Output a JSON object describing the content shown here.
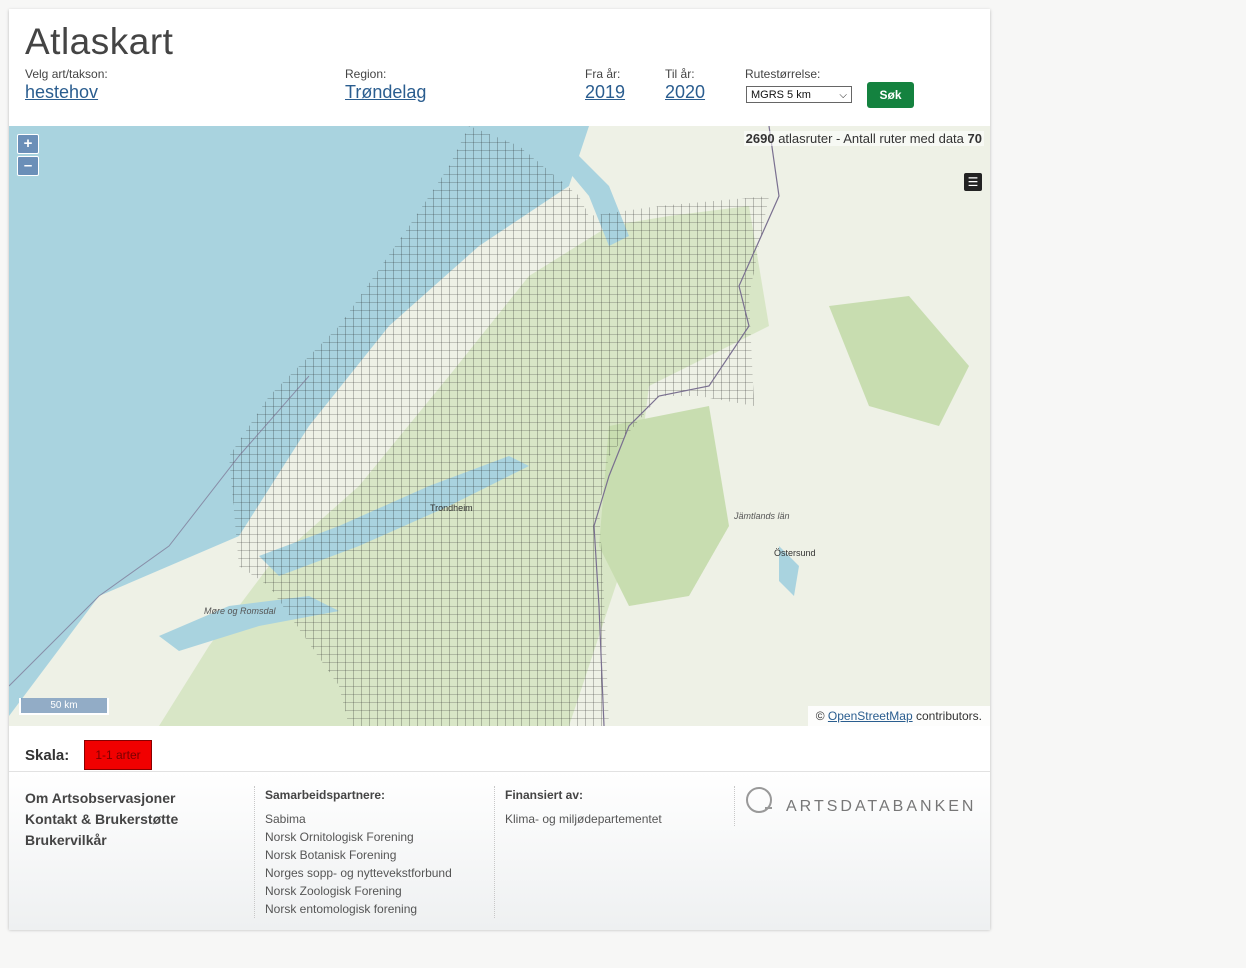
{
  "page_title": "Atlaskart",
  "filters": {
    "species_label": "Velg art/takson:",
    "species_value": "hestehov",
    "region_label": "Region:",
    "region_value": "Trøndelag",
    "from_label": "Fra år:",
    "from_value": "2019",
    "to_label": "Til år:",
    "to_value": "2020",
    "grid_label": "Rutestørrelse:",
    "grid_value": "MGRS 5 km",
    "search_button": "Søk"
  },
  "map": {
    "zoom_in": "+",
    "zoom_out": "–",
    "routes_count": "2690",
    "routes_text": "atlasruter - Antall ruter med data",
    "routes_with_data": "70",
    "scale_label": "50 km",
    "place_labels": [
      "Trondheim",
      "Jämtlands län",
      "Östersund",
      "Møre og Romsdal"
    ],
    "attribution_prefix": "©",
    "attribution_link": "OpenStreetMap",
    "attribution_suffix": "contributors.",
    "colors": {
      "sea": "#a9d3df",
      "land": "#eef1e6",
      "forest": "#c8ddb0",
      "grid": "#1a1a1a"
    }
  },
  "legend": {
    "title": "Skala:",
    "entry": "1-1 arter",
    "color": "#f10000"
  },
  "footer": {
    "main_links": [
      "Om Artsobservasjoner",
      "Kontakt & Brukerstøtte",
      "Brukervilkår"
    ],
    "partners_heading": "Samarbeidspartnere:",
    "partners": [
      "Sabima",
      "Norsk Ornitologisk Forening",
      "Norsk Botanisk Forening",
      "Norges sopp- og nyttevekstforbund",
      "Norsk Zoologisk Forening",
      "Norsk entomologisk forening"
    ],
    "funded_heading": "Finansiert av:",
    "funded": [
      "Klima- og miljødepartementet"
    ],
    "logo_text": "ARTSDATABANKEN"
  }
}
